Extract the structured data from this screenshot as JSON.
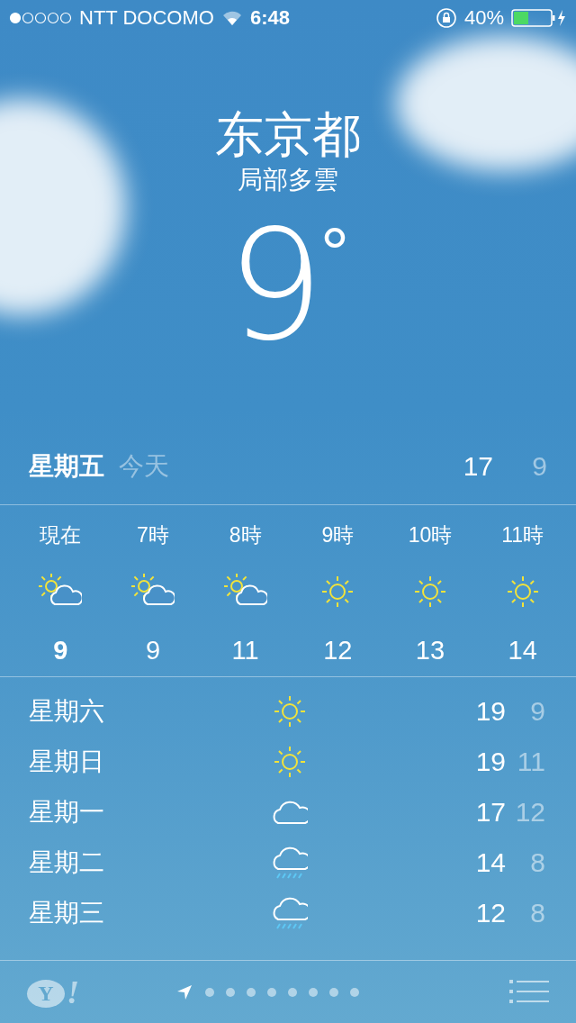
{
  "status_bar": {
    "carrier": "NTT DOCOMO",
    "time": "6:48",
    "battery": "40%"
  },
  "location": {
    "city": "东京都",
    "condition": "局部多雲",
    "temperature": "9",
    "degree": "°"
  },
  "today": {
    "day": "星期五",
    "label": "今天",
    "high": "17",
    "low": "9"
  },
  "hourly": [
    {
      "time": "現在",
      "kind": "partly_cloudy",
      "temp": "9",
      "current": true
    },
    {
      "time": "7時",
      "kind": "partly_cloudy",
      "temp": "9",
      "current": false
    },
    {
      "time": "8時",
      "kind": "partly_cloudy",
      "temp": "11",
      "current": false
    },
    {
      "time": "9時",
      "kind": "sunny",
      "temp": "12",
      "current": false
    },
    {
      "time": "10時",
      "kind": "sunny",
      "temp": "13",
      "current": false
    },
    {
      "time": "11時",
      "kind": "sunny",
      "temp": "14",
      "current": false
    }
  ],
  "daily": [
    {
      "day": "星期六",
      "kind": "sunny",
      "high": "19",
      "low": "9"
    },
    {
      "day": "星期日",
      "kind": "sunny",
      "high": "19",
      "low": "11"
    },
    {
      "day": "星期一",
      "kind": "cloudy",
      "high": "17",
      "low": "12"
    },
    {
      "day": "星期二",
      "kind": "rain",
      "high": "14",
      "low": "8"
    },
    {
      "day": "星期三",
      "kind": "rain",
      "high": "12",
      "low": "8"
    }
  ],
  "bottom_bar": {
    "logo": {
      "letter": "Y",
      "mark": "!"
    },
    "pages": [
      {
        "kind": "location",
        "selected": true
      },
      {
        "kind": "dot",
        "selected": false
      },
      {
        "kind": "dot",
        "selected": false
      },
      {
        "kind": "dot",
        "selected": false
      },
      {
        "kind": "dot",
        "selected": false
      },
      {
        "kind": "dot",
        "selected": false
      },
      {
        "kind": "dot",
        "selected": false
      },
      {
        "kind": "dot",
        "selected": false
      },
      {
        "kind": "dot",
        "selected": false
      }
    ]
  }
}
